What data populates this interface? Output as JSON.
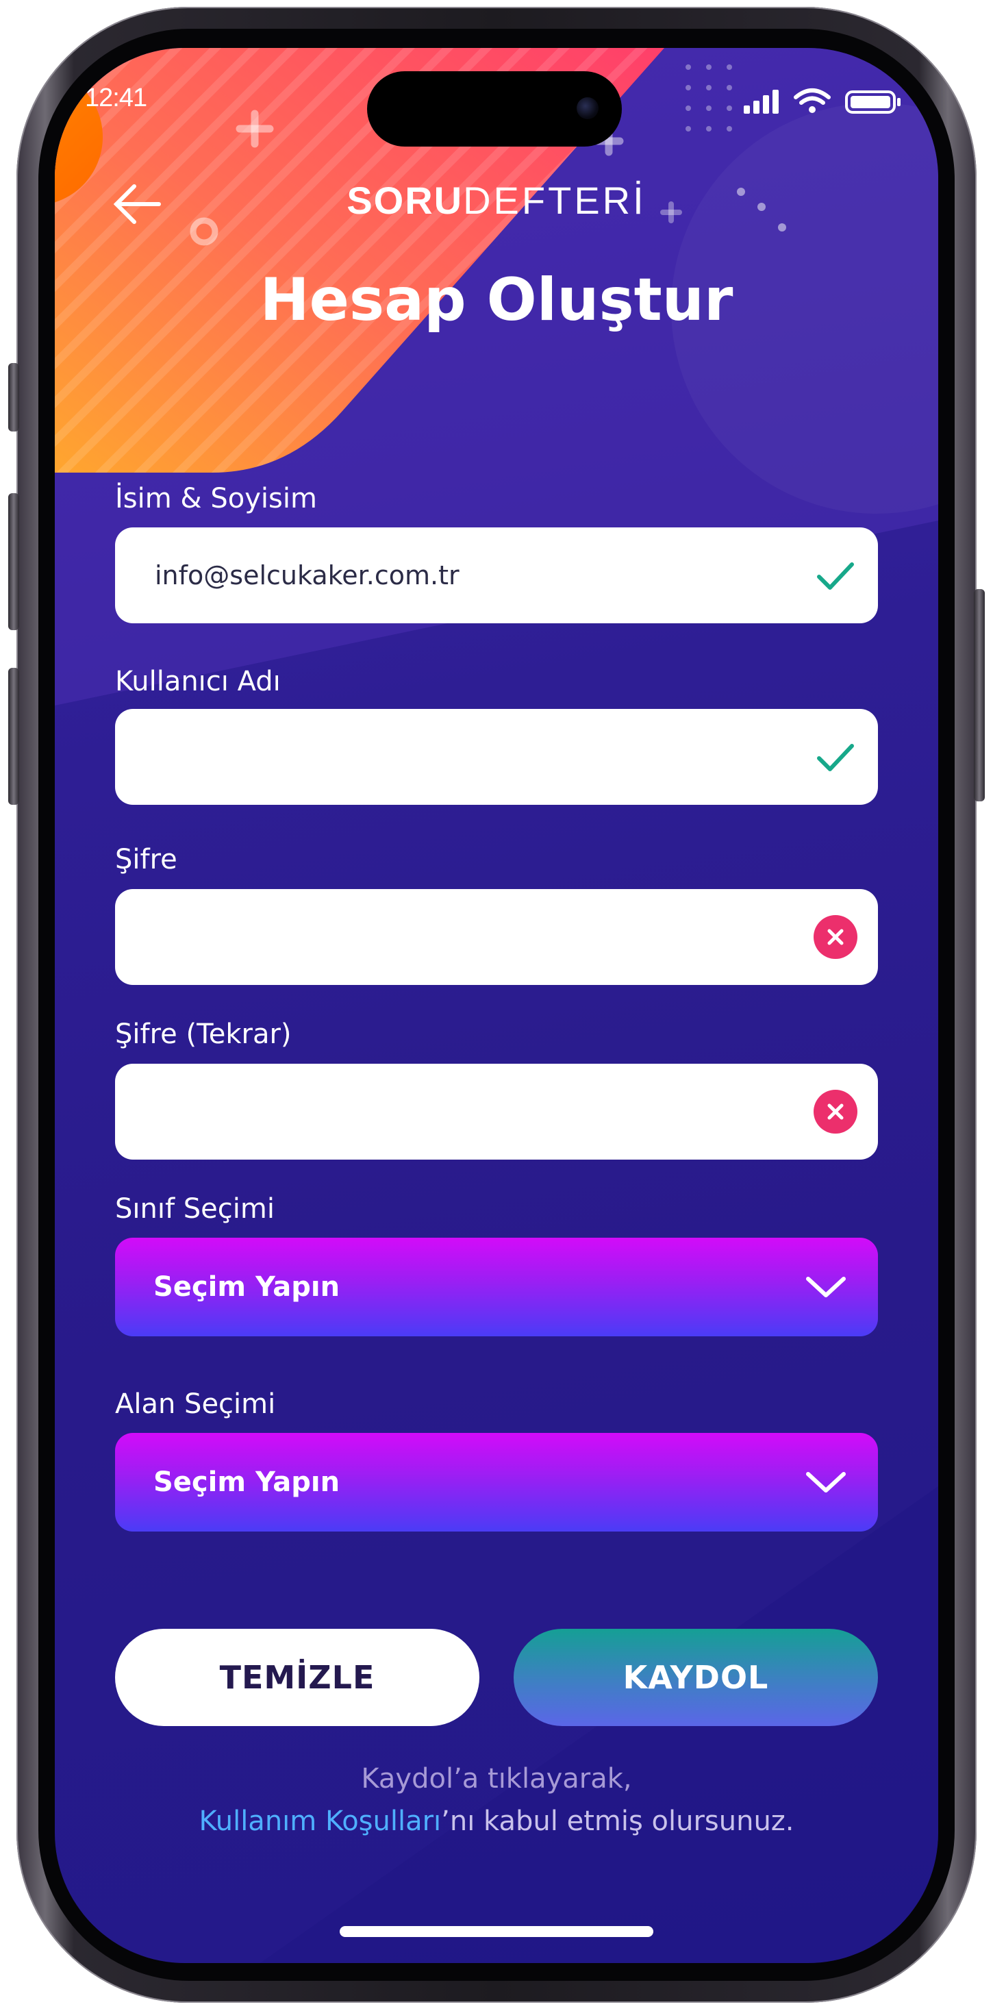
{
  "status_bar": {
    "time": "12:41"
  },
  "header": {
    "logo_bold": "SORU",
    "logo_light": "DEFTERİ",
    "title": "Hesap Oluştur"
  },
  "form": {
    "name": {
      "label": "İsim & Soyisim",
      "value": "info@selcukaker.com.tr",
      "state": "valid"
    },
    "username": {
      "label": "Kullanıcı Adı",
      "value": "",
      "state": "valid"
    },
    "password": {
      "label": "Şifre",
      "value": "",
      "state": "invalid"
    },
    "password_repeat": {
      "label": "Şifre (Tekrar)",
      "value": "",
      "state": "invalid"
    },
    "class_select": {
      "label": "Sınıf Seçimi",
      "selected": "Seçim Yapın"
    },
    "field_select": {
      "label": "Alan Seçimi",
      "selected": "Seçim Yapın"
    }
  },
  "buttons": {
    "clear": "TEMİZLE",
    "register": "KAYDOL"
  },
  "footer": {
    "line1": "Kaydol’a tıklayarak,",
    "link": "Kullanım Koşulları",
    "line2_rest": "’nı kabul etmiş olursunuz."
  },
  "colors": {
    "background": "#2e1e94",
    "valid_check": "#17a88a",
    "invalid_badge": "#ec2f6c",
    "link": "#4fb0ff"
  }
}
